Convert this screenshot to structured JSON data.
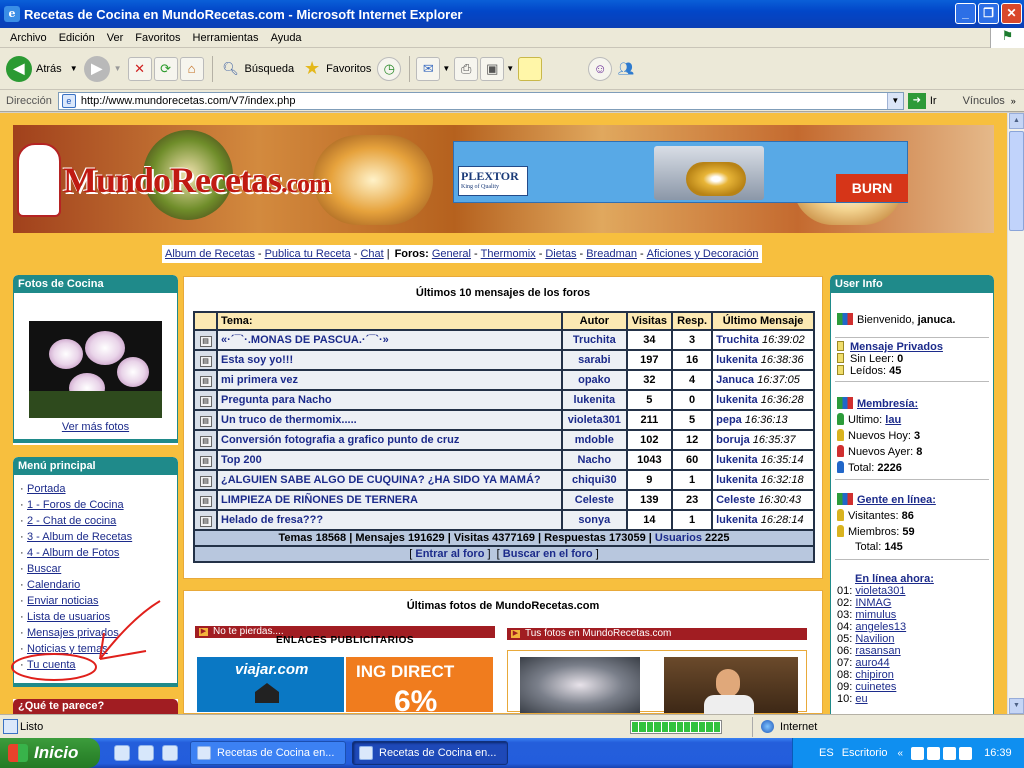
{
  "window": {
    "title": "Recetas de Cocina en MundoRecetas.com - Microsoft Internet Explorer"
  },
  "menu": [
    "Archivo",
    "Edición",
    "Ver",
    "Favoritos",
    "Herramientas",
    "Ayuda"
  ],
  "toolbar": {
    "back": "Atrás",
    "search": "Búsqueda",
    "favorites": "Favoritos"
  },
  "address": {
    "label": "Dirección",
    "url": "http://www.mundorecetas.com/V7/index.php",
    "go": "Ir",
    "links": "Vínculos"
  },
  "site": {
    "logo": "MundoRecetas",
    "logo_suffix": ".com",
    "banner_ad": {
      "brand": "PLEXTOR",
      "tagline": "King of Quality",
      "cta": "BURN"
    },
    "nav": {
      "links": [
        "Album de Recetas",
        "Publica tu Receta",
        "Chat"
      ],
      "forums_label": "Foros:",
      "forums": [
        "General",
        "Thermomix",
        "Dietas",
        "Breadman",
        "Aficiones y Decoración"
      ]
    },
    "photos": {
      "title": "Fotos de Cocina",
      "more": "Ver más fotos"
    },
    "main_menu": {
      "title": "Menú principal",
      "items": [
        "Portada",
        "1 - Foros de Cocina",
        "2 - Chat de cocina",
        "3 - Album de Recetas",
        "4 - Album de Fotos",
        "Buscar",
        "Calendario",
        "Enviar noticias",
        "Lista de usuarios",
        "Mensajes privados",
        "Noticias y temas",
        "Tu cuenta"
      ]
    },
    "poll": {
      "title": "¿Qué te parece?"
    },
    "forum": {
      "title": "Últimos 10 mensajes de los foros",
      "headers": [
        "Tema:",
        "Autor",
        "Visitas",
        "Resp.",
        "Último Mensaje"
      ],
      "rows": [
        {
          "topic": "«·´¯`·.MONAS DE PASCUA.·´¯`·»",
          "author": "Truchita",
          "visits": "34",
          "replies": "3",
          "last_user": "Truchita",
          "last_time": "16:39:02"
        },
        {
          "topic": "Esta soy yo!!!",
          "author": "sarabi",
          "visits": "197",
          "replies": "16",
          "last_user": "lukenita",
          "last_time": "16:38:36"
        },
        {
          "topic": "mi primera vez",
          "author": "opako",
          "visits": "32",
          "replies": "4",
          "last_user": "Januca",
          "last_time": "16:37:05"
        },
        {
          "topic": "Pregunta para Nacho",
          "author": "lukenita",
          "visits": "5",
          "replies": "0",
          "last_user": "lukenita",
          "last_time": "16:36:28"
        },
        {
          "topic": "Un truco de thermomix.....",
          "author": "violeta301",
          "visits": "211",
          "replies": "5",
          "last_user": "pepa",
          "last_time": "16:36:13"
        },
        {
          "topic": "Conversión fotografia a grafico punto de cruz",
          "author": "mdoble",
          "visits": "102",
          "replies": "12",
          "last_user": "boruja",
          "last_time": "16:35:37"
        },
        {
          "topic": "Top 200",
          "author": "Nacho",
          "visits": "1043",
          "replies": "60",
          "last_user": "lukenita",
          "last_time": "16:35:14"
        },
        {
          "topic": "¿ALGUIEN SABE ALGO DE CUQUINA? ¿HA SIDO YA MAMÁ?",
          "author": "chiqui30",
          "visits": "9",
          "replies": "1",
          "last_user": "lukenita",
          "last_time": "16:32:18"
        },
        {
          "topic": "LIMPIEZA DE RIÑONES DE TERNERA",
          "author": "Celeste",
          "visits": "139",
          "replies": "23",
          "last_user": "Celeste",
          "last_time": "16:30:43"
        },
        {
          "topic": "Helado de fresa???",
          "author": "sonya",
          "visits": "14",
          "replies": "1",
          "last_user": "lukenita",
          "last_time": "16:28:14"
        }
      ],
      "stats": "Temas 18568 | Mensajes 191629 | Visitas 4377169 | Respuestas 173059 |",
      "users_link": "Usuarios",
      "users_count": "2225",
      "enter_link": "Entrar al foro",
      "search_link": "Buscar en el foro"
    },
    "photos_section": {
      "title": "Últimas fotos de MundoRecetas.com",
      "no_miss": "No te pierdas....",
      "your_photos": "Tus fotos en MundoRecetas.com",
      "ads_title": "ENLACES PUBLICITARIOS",
      "ad1": "viajar.com",
      "ad2": "ING DIRECT",
      "ad2_big": "6%"
    },
    "user_info": {
      "title": "User Info",
      "welcome": "Bienvenido,",
      "username": "januca.",
      "pm_link": "Mensaje Privados",
      "unread_label": "Sin Leer:",
      "unread": "0",
      "read_label": "Leídos:",
      "read": "45",
      "membership": "Membresía:",
      "last_label": "Ultimo:",
      "last_member": "lau",
      "today_label": "Nuevos Hoy:",
      "today": "3",
      "yesterday_label": "Nuevos Ayer:",
      "yesterday": "8",
      "total_label": "Total:",
      "total": "2226",
      "online_title": "Gente en línea:",
      "visitors_label": "Visitantes:",
      "visitors": "86",
      "members_label": "Miembros:",
      "members": "59",
      "online_total_label": "Total:",
      "online_total": "145",
      "online_now": "En línea ahora:",
      "online_users": [
        {
          "n": "01:",
          "u": "violeta301"
        },
        {
          "n": "02:",
          "u": "INMAG"
        },
        {
          "n": "03:",
          "u": "mimulus"
        },
        {
          "n": "04:",
          "u": "angeles13"
        },
        {
          "n": "05:",
          "u": "Navilion"
        },
        {
          "n": "06:",
          "u": "rasansan"
        },
        {
          "n": "07:",
          "u": "auro44"
        },
        {
          "n": "08:",
          "u": "chipiron"
        },
        {
          "n": "09:",
          "u": "cuinetes"
        },
        {
          "n": "10:",
          "u": "eu"
        }
      ]
    }
  },
  "status": {
    "text": "Listo",
    "zone": "Internet"
  },
  "taskbar": {
    "start": "Inicio",
    "tasks": [
      "Recetas de Cocina en...",
      "Recetas de Cocina en..."
    ],
    "lang": "ES",
    "desktop": "Escritorio",
    "clock": "16:39"
  },
  "colors": {
    "page_bg": "#f7bf3e",
    "box_header": "#1f8a8a",
    "link": "#1c2b8b",
    "annotation": "#e0201b"
  }
}
